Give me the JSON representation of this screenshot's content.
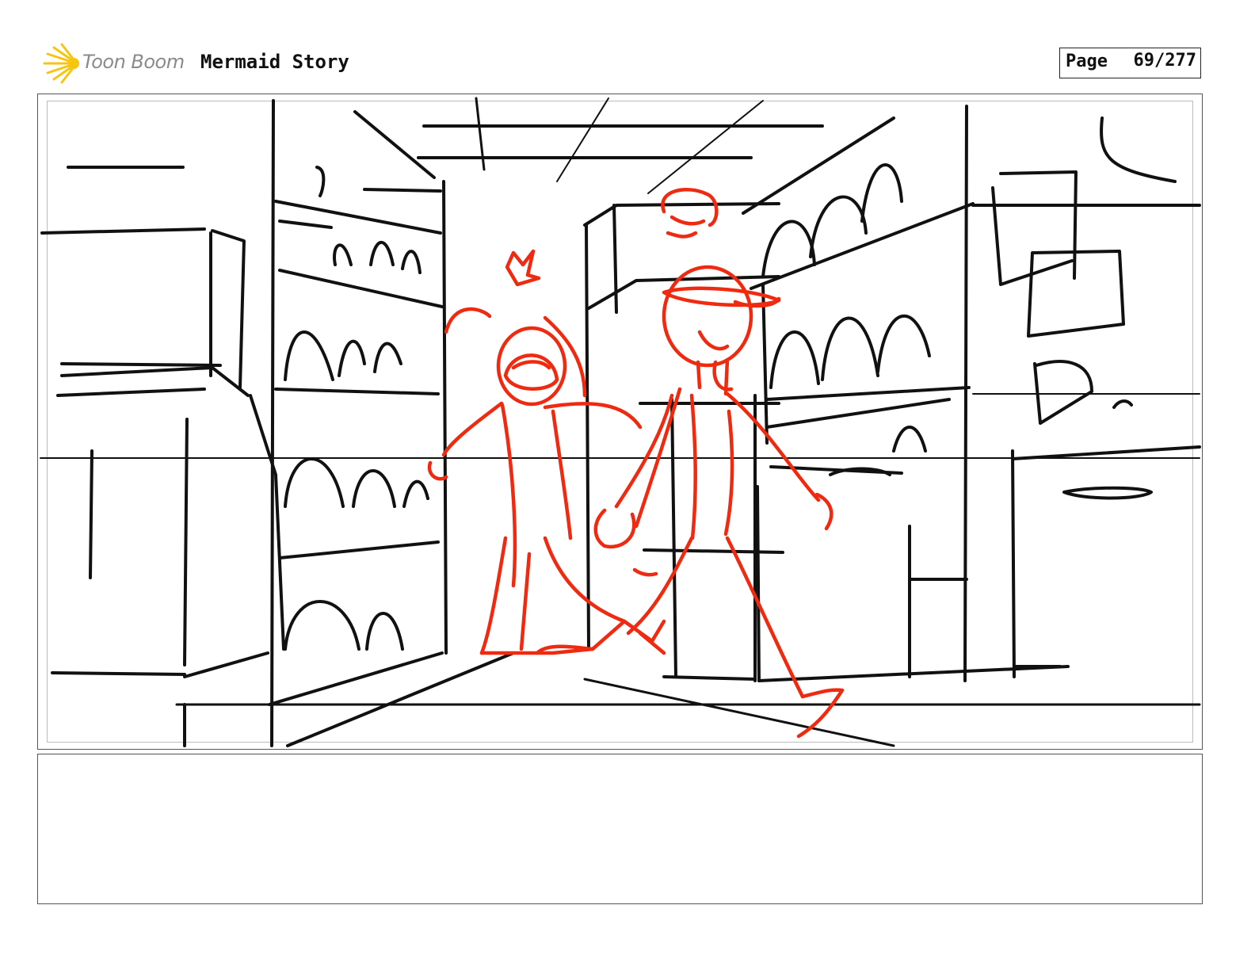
{
  "header": {
    "logo_text": "Toon Boom",
    "project_title": "Mermaid Story",
    "page_label": "Page",
    "page_number": "69/277"
  },
  "colors": {
    "sketch_ink": "#111111",
    "character_ink": "#f02a10",
    "logo_yellow": "#f7c511"
  },
  "panel": {
    "notes_text": ""
  }
}
